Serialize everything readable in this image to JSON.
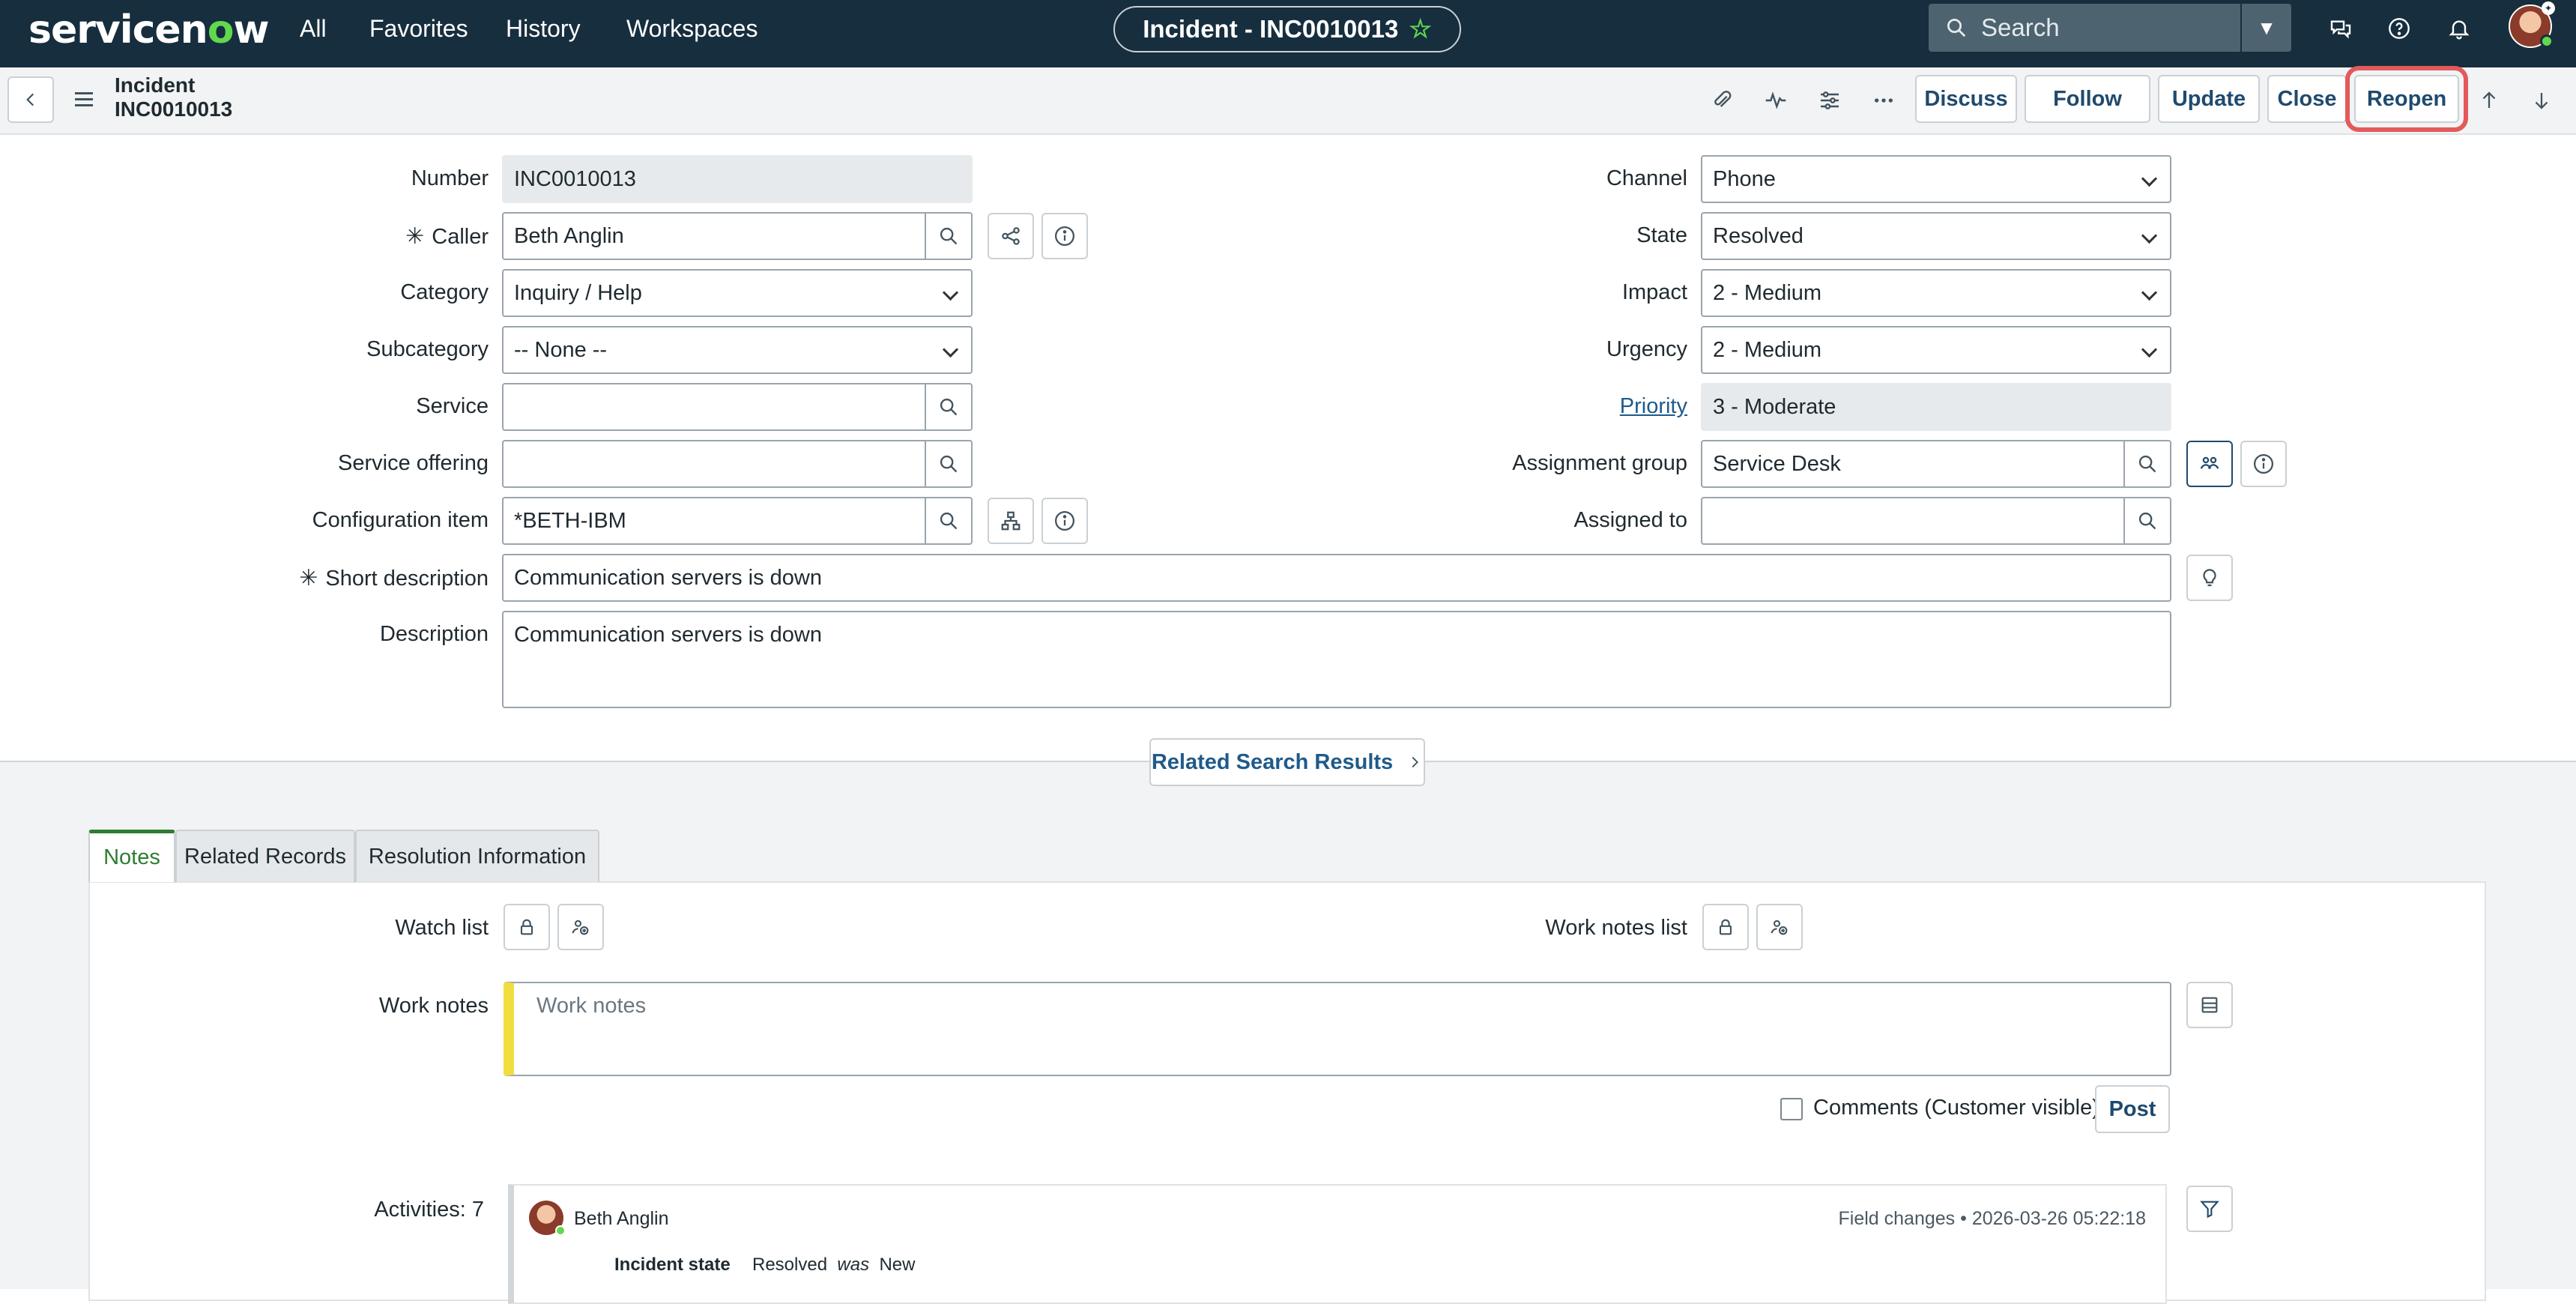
{
  "nav": {
    "logo_prefix": "servicen",
    "logo_o": "o",
    "logo_suffix": "w",
    "links": [
      "All",
      "Favorites",
      "History",
      "Workspaces"
    ],
    "record_pill": "Incident - INC0010013",
    "search_placeholder": "Search"
  },
  "header": {
    "title_line1": "Incident",
    "title_line2": "INC0010013",
    "buttons": {
      "discuss": "Discuss",
      "follow": "Follow",
      "update": "Update",
      "close": "Close",
      "reopen": "Reopen"
    }
  },
  "form": {
    "left": [
      {
        "label": "Number",
        "value": "INC0010013"
      },
      {
        "label": "Caller",
        "value": "Beth Anglin",
        "required": true
      },
      {
        "label": "Category",
        "value": "Inquiry / Help"
      },
      {
        "label": "Subcategory",
        "value": "-- None --"
      },
      {
        "label": "Service",
        "value": ""
      },
      {
        "label": "Service offering",
        "value": ""
      },
      {
        "label": "Configuration item",
        "value": "*BETH-IBM"
      }
    ],
    "right": [
      {
        "label": "Channel",
        "value": "Phone"
      },
      {
        "label": "State",
        "value": "Resolved"
      },
      {
        "label": "Impact",
        "value": "2 - Medium"
      },
      {
        "label": "Urgency",
        "value": "2 - Medium"
      },
      {
        "label": "Priority",
        "value": "3 - Moderate"
      },
      {
        "label": "Assignment group",
        "value": "Service Desk"
      },
      {
        "label": "Assigned to",
        "value": ""
      }
    ],
    "short_description": {
      "label": "Short description",
      "value": "Communication servers is down"
    },
    "description": {
      "label": "Description",
      "value": "Communication servers is down"
    },
    "required_mark": "✳"
  },
  "related_search": "Related Search Results",
  "tabs": [
    "Notes",
    "Related Records",
    "Resolution Information"
  ],
  "notes": {
    "watch_list": "Watch list",
    "work_notes_list": "Work notes list",
    "work_notes_label": "Work notes",
    "work_notes_placeholder": "Work notes",
    "comments_label": "Comments (Customer visible)",
    "post": "Post",
    "activities_label": "Activities: 7"
  },
  "activity": {
    "user": "Beth Anglin",
    "type": "Field changes",
    "separator": "•",
    "timestamp": "2026-03-26 05:22:18",
    "field": "Incident state",
    "new_value": "Resolved",
    "was": "was",
    "old_value": "New"
  }
}
